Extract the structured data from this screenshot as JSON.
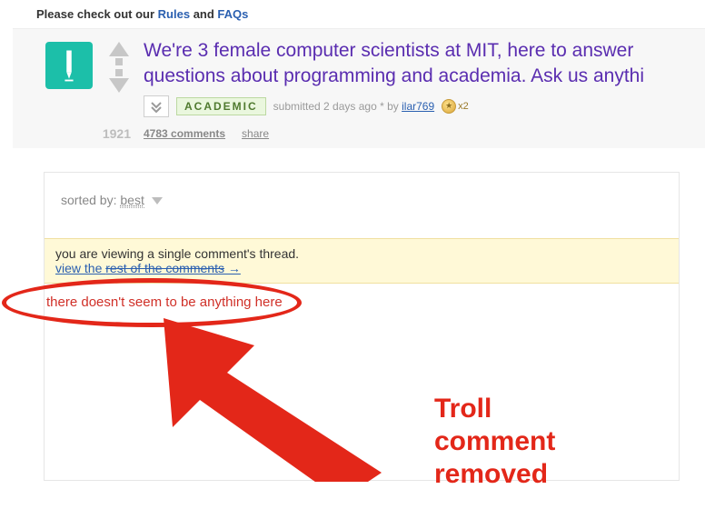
{
  "topline": {
    "prefix": "Please check out our ",
    "link1": "Rules",
    "and": " and ",
    "link2": "FAQs"
  },
  "post": {
    "title": "We're 3 female computer scientists at MIT, here to answer questions about programming and academia. Ask us anythi",
    "flair": "ACADEMIC",
    "submitted_prefix": "submitted ",
    "age": "2 days ago",
    "by": " * by ",
    "author": "ilar769",
    "gild_count": "x2",
    "score": "1921",
    "comments": "4783 comments",
    "share": "share"
  },
  "sort": {
    "label": "sorted by: ",
    "value": "best"
  },
  "infobar": {
    "line1": "you are viewing a single comment's thread.",
    "link_prefix": "view the ",
    "link_strike": "rest of the comments",
    "arrow": " →"
  },
  "empty": "there doesn't seem to be anything here",
  "annotation": {
    "text": "Troll\ncomment\nremoved"
  }
}
